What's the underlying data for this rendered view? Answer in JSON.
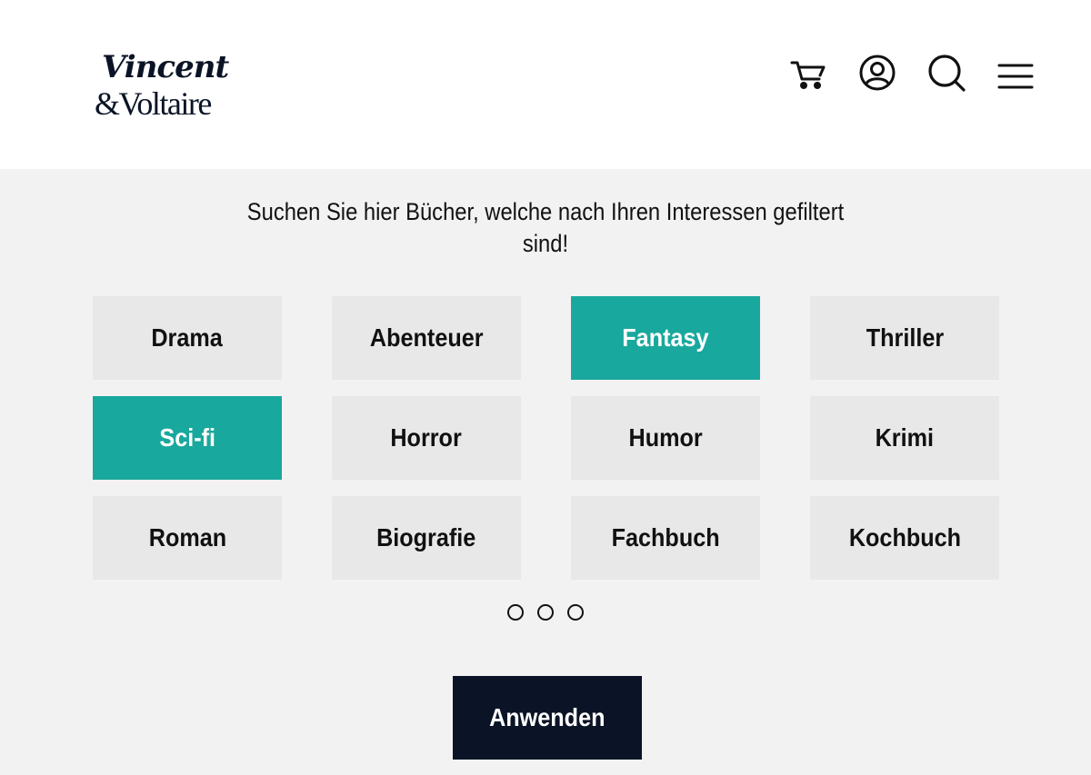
{
  "header": {
    "logo_line1": "Vincent",
    "logo_line2": "&Voltaire",
    "icons": [
      "cart-icon",
      "account-icon",
      "search-icon",
      "menu-icon"
    ]
  },
  "main": {
    "heading": "Suchen Sie hier Bücher, welche nach Ihren  Interessen gefiltert sind!",
    "genres": [
      {
        "label": "Drama",
        "selected": false
      },
      {
        "label": "Abenteuer",
        "selected": false
      },
      {
        "label": "Fantasy",
        "selected": true
      },
      {
        "label": "Thriller",
        "selected": false
      },
      {
        "label": "Sci-fi",
        "selected": true
      },
      {
        "label": "Horror",
        "selected": false
      },
      {
        "label": "Humor",
        "selected": false
      },
      {
        "label": "Krimi",
        "selected": false
      },
      {
        "label": "Roman",
        "selected": false
      },
      {
        "label": "Biografie",
        "selected": false
      },
      {
        "label": "Fachbuch",
        "selected": false
      },
      {
        "label": "Kochbuch",
        "selected": false
      }
    ],
    "pagination": {
      "pages": 3
    },
    "apply_label": "Anwenden"
  },
  "colors": {
    "accent": "#19a89d",
    "dark": "#0b1426",
    "chip": "#e8e8e8",
    "background": "#f2f2f2"
  }
}
